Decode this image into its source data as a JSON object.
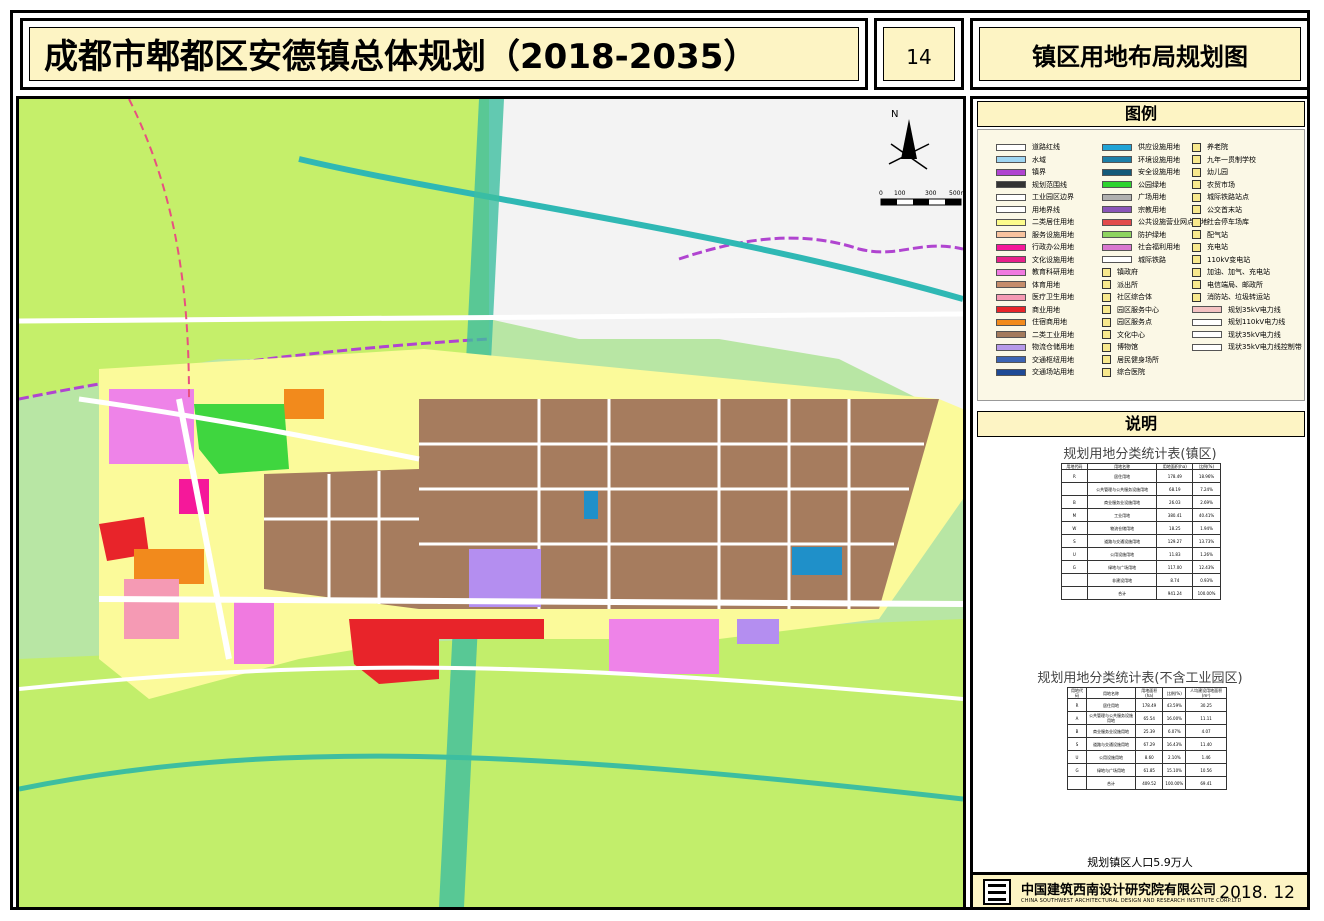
{
  "title": "成都市郫都区安德镇总体规划（2018-2035）",
  "sheet_number": "14",
  "sheet_title": "镇区用地布局规划图",
  "legend_title": "图例",
  "description_title": "说明",
  "table1_title": "规划用地分类统计表(镇区)",
  "table2_title": "规划用地分类统计表(不含工业园区)",
  "population_note": "规划镇区人口5.9万人",
  "company_cn": "中国建筑西南设计研究院有限公司",
  "company_en": "CHINA SOUTHWEST ARCHITECTURAL DESIGN AND RESEARCH INSTITUTE CORP.LTD",
  "date": "2018. 12",
  "map": {
    "north_label": "N",
    "scale_labels": [
      "0",
      "100",
      "300",
      "500m"
    ]
  },
  "legend_columns": [
    [
      {
        "label": "道路红线",
        "color": "#ffffff"
      },
      {
        "label": "水域",
        "color": "#9fd6f2"
      },
      {
        "label": "镇界",
        "color": "#b044d0"
      },
      {
        "label": "规划范围线",
        "color": "#333333"
      },
      {
        "label": "工业园区边界",
        "color": "#ffffff"
      },
      {
        "label": "用地界线",
        "color": "#ffffff"
      },
      {
        "label": "二类居住用地",
        "color": "#fdfc8c"
      },
      {
        "label": "服务设施用地",
        "color": "#f8c39e"
      },
      {
        "label": "行政办公用地",
        "color": "#f5189a"
      },
      {
        "label": "文化设施用地",
        "color": "#e8208a"
      },
      {
        "label": "教育科研用地",
        "color": "#f07ae0"
      },
      {
        "label": "体育用地",
        "color": "#c48c6b"
      },
      {
        "label": "医疗卫生用地",
        "color": "#f59ab4"
      },
      {
        "label": "商业用地",
        "color": "#e8242a"
      },
      {
        "label": "住宿商用地",
        "color": "#f28a1c"
      },
      {
        "label": "二类工业用地",
        "color": "#a37a5c"
      },
      {
        "label": "物流仓储用地",
        "color": "#b69aea"
      },
      {
        "label": "交通枢纽用地",
        "color": "#3c64b4"
      },
      {
        "label": "交通场站用地",
        "color": "#1e4a96"
      }
    ],
    [
      {
        "label": "供应设施用地",
        "color": "#21a4d6"
      },
      {
        "label": "环境设施用地",
        "color": "#1c7fa8"
      },
      {
        "label": "安全设施用地",
        "color": "#145a7a"
      },
      {
        "label": "公园绿地",
        "color": "#2ed42e"
      },
      {
        "label": "广场用地",
        "color": "#b0b0b0"
      },
      {
        "label": "宗教用地",
        "color": "#8a56b8"
      },
      {
        "label": "公共设施营业网点用地",
        "color": "#e24b4b"
      },
      {
        "label": "防护绿地",
        "color": "#8ed45f"
      },
      {
        "label": "社会福利用地",
        "color": "#d978d0"
      },
      {
        "label": "城际铁路",
        "color": "#ffffff"
      },
      {
        "label": "镇政府",
        "icon": true
      },
      {
        "label": "派出所",
        "icon": true
      },
      {
        "label": "社区综合体",
        "icon": true
      },
      {
        "label": "园区服务中心",
        "icon": true
      },
      {
        "label": "园区服务点",
        "icon": true
      },
      {
        "label": "文化中心",
        "icon": true
      },
      {
        "label": "博物馆",
        "icon": true
      },
      {
        "label": "居民健身场所",
        "icon": true
      },
      {
        "label": "综合医院",
        "icon": true
      }
    ],
    [
      {
        "label": "养老院",
        "icon": true
      },
      {
        "label": "九年一贯制学校",
        "icon": true
      },
      {
        "label": "幼儿园",
        "icon": true
      },
      {
        "label": "农贸市场",
        "icon": true
      },
      {
        "label": "城际铁路站点",
        "icon": true
      },
      {
        "label": "公交首末站",
        "icon": true
      },
      {
        "label": "社会停车场库",
        "icon": true
      },
      {
        "label": "配气站",
        "icon": true
      },
      {
        "label": "充电站",
        "icon": true
      },
      {
        "label": "110kV变电站",
        "icon": true
      },
      {
        "label": "加油、加气、充电站",
        "icon": true
      },
      {
        "label": "电信端局、邮政所",
        "icon": true
      },
      {
        "label": "消防站、垃圾转运站",
        "icon": true
      },
      {
        "label": "规划35kV电力线",
        "color": "#f4c2c2"
      },
      {
        "label": "规划110kV电力线",
        "color": "#ffffff"
      },
      {
        "label": "现状35kV电力线",
        "color": "#ffffff"
      },
      {
        "label": "现状35kV电力线控制带",
        "color": "#ffffff"
      }
    ]
  ],
  "table1": {
    "headers": [
      "用地代码",
      "用地名称",
      "用地面积(ha)",
      "比例(%)"
    ],
    "rows": [
      [
        "R",
        "居住用地",
        "178.49",
        "18.96%"
      ],
      [
        "",
        "公共管理与公共服务设施用地",
        "68.19",
        "7.24%"
      ],
      [
        "B",
        "商业服务业设施用地",
        "26.03",
        "2.69%"
      ],
      [
        "M",
        "工业用地",
        "380.41",
        "40.41%"
      ],
      [
        "W",
        "物流仓储用地",
        "18.25",
        "1.94%"
      ],
      [
        "S",
        "道路与交通设施用地",
        "129.27",
        "13.73%"
      ],
      [
        "U",
        "公用设施用地",
        "11.83",
        "1.26%"
      ],
      [
        "G",
        "绿地与广场用地",
        "117.00",
        "12.43%"
      ],
      [
        "",
        "非建设用地",
        "8.74",
        "0.93%"
      ],
      [
        "",
        "合计",
        "941.24",
        "100.00%"
      ]
    ]
  },
  "table2": {
    "headers": [
      "用地代码",
      "用地名称",
      "用地面积(ha)",
      "比例(%)",
      "人均建设用地面积(m²)"
    ],
    "rows": [
      [
        "R",
        "居住用地",
        "178.49",
        "43.59%",
        "30.25"
      ],
      [
        "A",
        "公共管理与公共服务设施用地",
        "65.54",
        "16.00%",
        "11.11"
      ],
      [
        "B",
        "商业服务业设施用地",
        "25.39",
        "6.07%",
        "4.07"
      ],
      [
        "S",
        "道路与交通设施用地",
        "67.29",
        "16.43%",
        "11.40"
      ],
      [
        "U",
        "公用设施用地",
        "8.60",
        "2.10%",
        "1.46"
      ],
      [
        "G",
        "绿地与广场用地",
        "61.85",
        "15.10%",
        "10.56"
      ],
      [
        "",
        "合计",
        "409.52",
        "100.00%",
        "69.41"
      ]
    ]
  }
}
